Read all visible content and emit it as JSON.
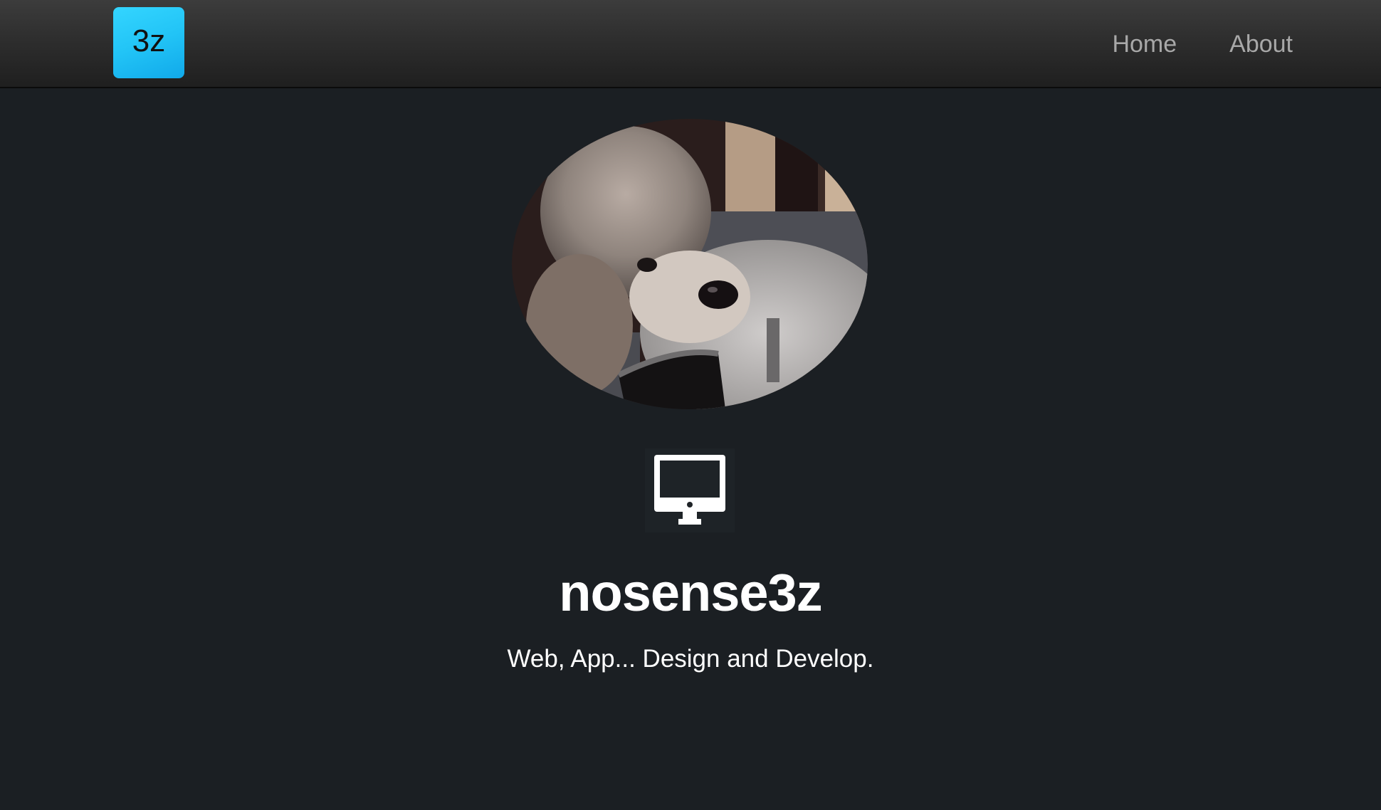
{
  "header": {
    "logo_text": "3z",
    "nav": [
      {
        "label": "Home"
      },
      {
        "label": "About"
      }
    ]
  },
  "profile": {
    "avatar_icon": "poodle-photo",
    "monitor_icon": "desktop-monitor-icon",
    "name": "nosense3z",
    "tagline": "Web, App... Design and Develop."
  },
  "colors": {
    "background": "#1b1f23",
    "header": "#2e2e2e",
    "logo_accent": "#22c4f6",
    "nav_text": "#a8a8a8",
    "text": "#ffffff"
  }
}
